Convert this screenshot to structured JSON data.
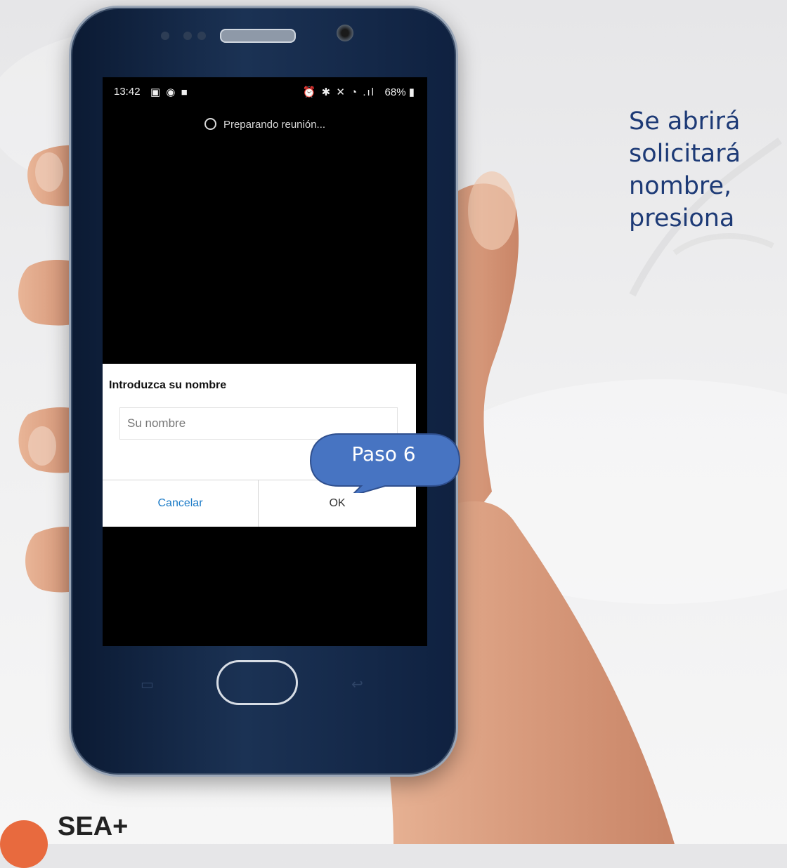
{
  "description_text": "Se abrirá\nsolicitará\nnombre,\npresiona",
  "status_bar": {
    "time": "13:42",
    "left_icons": "▣ ◉ ■",
    "right_icons": "⏰ ✱ ✕ ◔ .ıl",
    "battery": "68% ▮"
  },
  "loading_text": "Preparando reunión...",
  "dialog": {
    "title": "Introduzca su nombre",
    "input_placeholder": "Su nombre",
    "input_value": "",
    "cancel_label": "Cancelar",
    "ok_label": "OK"
  },
  "callout": {
    "label": "Paso 6"
  },
  "logo": {
    "text": "SEA+",
    "script": ""
  },
  "colors": {
    "side_text": "#1d3a76",
    "callout_fill": "#4774c2",
    "cancel_text": "#1a7ac7",
    "logo_accent": "#e86a3e"
  }
}
